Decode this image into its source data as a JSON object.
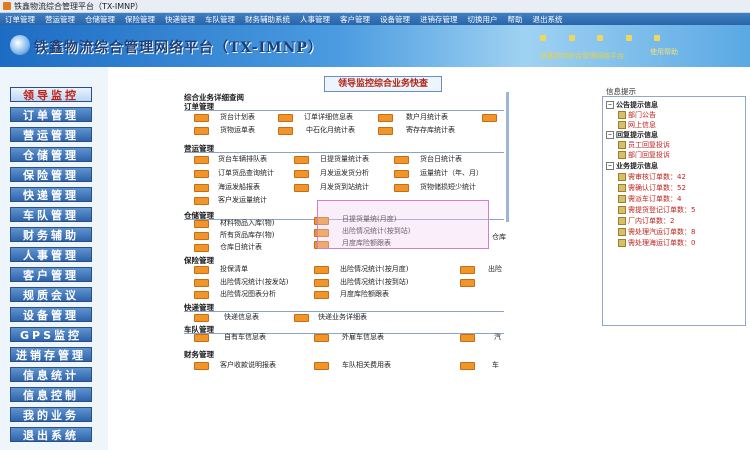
{
  "window": {
    "title": "铁鑫物流综合管理平台（TX-IMNP）"
  },
  "menubar": [
    "订单管理",
    "营运管理",
    "仓储管理",
    "保险管理",
    "快递管理",
    "车队管理",
    "财务辅助系统",
    "人事管理",
    "客户管理",
    "设备管理",
    "进销存管理",
    "切换用户",
    "帮助",
    "退出系统"
  ],
  "banner": {
    "brand": "铁鑫物流综合管理网络平台（TX-IMNP）",
    "sys_text": "铁鑫物流综合管理网络平台",
    "help_text": "使用帮助"
  },
  "leftnav": [
    "领导监控",
    "订单管理",
    "营运管理",
    "仓储管理",
    "保险管理",
    "快递管理",
    "车队管理",
    "财务辅助",
    "人事管理",
    "客户管理",
    "规质会议",
    "设备管理",
    "GPS监控",
    "进销存管理",
    "信息统计",
    "信息控制",
    "我的业务",
    "退出系统"
  ],
  "main": {
    "page_title": "领导监控综合业务快查",
    "header": "综合业务详细查阅",
    "sections": [
      {
        "title": "订单管理",
        "items": [
          "货台计划表",
          "订单详细信息表",
          "数户月统计表",
          "货物运单表",
          "中石化月统计表",
          "寄存存库统计表"
        ]
      },
      {
        "title": "营运管理",
        "items": [
          "货台车辆排队表",
          "日提货量统计表",
          "货台日统计表",
          "订单货品查询统计",
          "月发运发货分析",
          "运量统计（年、月）",
          "海运发船报表",
          "月发货到站统计",
          "货物储损短少统计",
          "客户发运量统计"
        ]
      },
      {
        "title": "仓储管理",
        "items": [
          "材料物品入库(物)",
          "日提货量统(月度)",
          "所有货品库存(物)",
          "出险情况统计(按到站)",
          "仓库日统计表",
          "月度库险额跟表",
          "仓库"
        ]
      },
      {
        "title": "保险管理",
        "items": [
          "投保清单",
          "出险情况统计(按月度)",
          "出险",
          "出险情况统计(按发站)",
          "出险情况统计(按到站)",
          "出险情况图表分析",
          "月度库险额跟表"
        ]
      },
      {
        "title": "快递管理",
        "items": [
          "快递信息表",
          "快递业务详细表"
        ]
      },
      {
        "title": "车队管理",
        "items": [
          "自有车信息表",
          "外雇车信息表",
          "汽"
        ]
      },
      {
        "title": "财务管理",
        "items": [
          "客户收款说明报表",
          "车队相关费用表",
          "车"
        ]
      }
    ]
  },
  "rightpanel": {
    "title": "信息提示",
    "groups": [
      {
        "label": "公告提示信息",
        "items": [
          "部门公告",
          "网上信息"
        ]
      },
      {
        "label": "回复提示信息",
        "items": [
          "员工回复投诉",
          "部门回复投诉"
        ]
      },
      {
        "label": "业务提示信息",
        "items": [
          "需审核订单数：42",
          "需确认订单数：52",
          "需派车订单数：4",
          "需提货登记订单数：5",
          "厂内订单数：2",
          "需处理汽运订单数：8",
          "需处理海运订单数：0"
        ]
      }
    ]
  },
  "colors": {
    "accent": "#2a64a8",
    "alert": "#c0221a",
    "report_icon": "#f0952a"
  }
}
